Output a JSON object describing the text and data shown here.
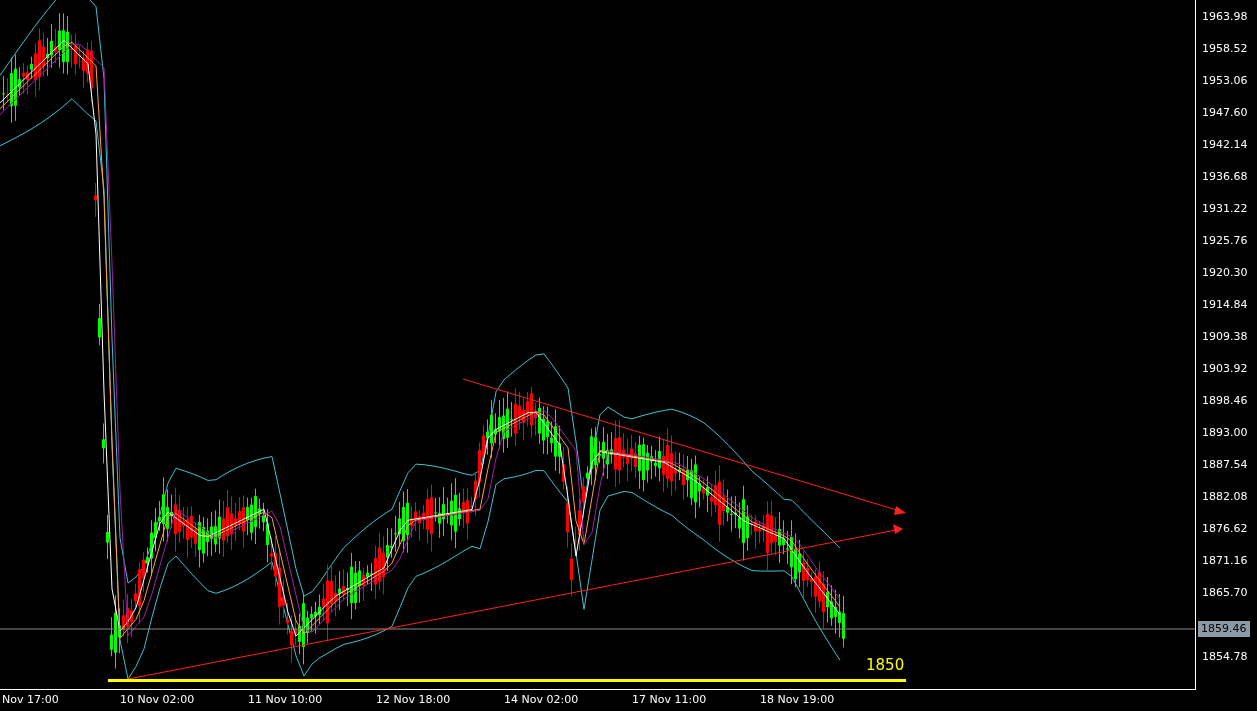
{
  "price_axis": {
    "labels": [
      "1963.98",
      "1958.52",
      "1953.06",
      "1947.60",
      "1942.14",
      "1936.68",
      "1931.22",
      "1925.76",
      "1920.30",
      "1914.84",
      "1909.38",
      "1903.92",
      "1898.46",
      "1893.00",
      "1887.54",
      "1882.08",
      "1876.62",
      "1871.16",
      "1865.70",
      "1854.78"
    ],
    "current_price": "1859.46"
  },
  "time_axis": {
    "labels": [
      "Nov 17:00",
      "10 Nov 02:00",
      "11 Nov 10:00",
      "12 Nov 18:00",
      "14 Nov 02:00",
      "17 Nov 11:00",
      "18 Nov 19:00"
    ]
  },
  "level_label": "1850"
}
